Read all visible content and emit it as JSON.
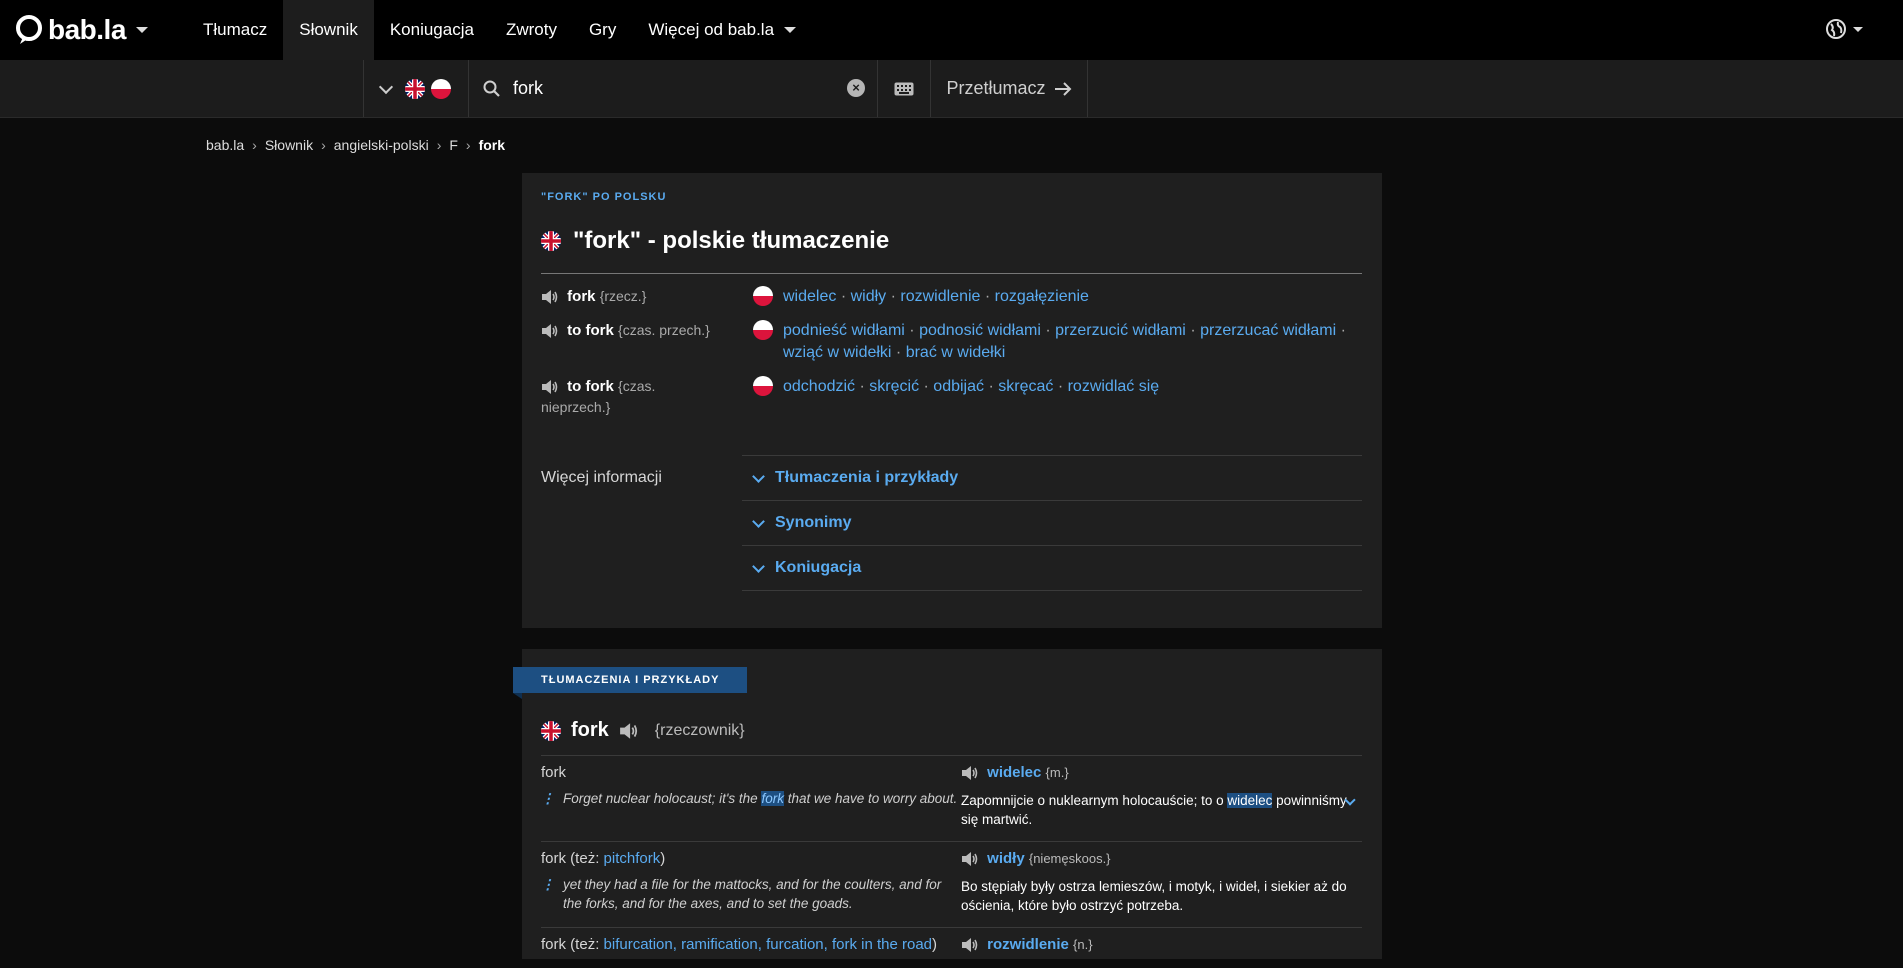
{
  "nav": {
    "logo": "bab.la",
    "items": [
      {
        "label": "Tłumacz",
        "active": false
      },
      {
        "label": "Słownik",
        "active": true
      },
      {
        "label": "Koniugacja",
        "active": false
      },
      {
        "label": "Zwroty",
        "active": false
      },
      {
        "label": "Gry",
        "active": false
      }
    ],
    "more": "Więcej od bab.la"
  },
  "search": {
    "value": "fork",
    "translator": "Przetłumacz"
  },
  "breadcrumb": [
    "bab.la",
    "Słownik",
    "angielski-polski",
    "F",
    "fork"
  ],
  "summary": {
    "eyebrow": "\"FORK\" PO POLSKU",
    "title": "\"fork\" - polskie tłumaczenie",
    "rows": [
      {
        "term": "fork",
        "pos": "{rzecz.}",
        "words": [
          "widelec",
          "widły",
          "rozwidlenie",
          "rozgałęzienie"
        ]
      },
      {
        "term": "to fork",
        "pos": "{czas. przech.}",
        "words": [
          "podnieść widłami",
          "podnosić widłami",
          "przerzucić widłami",
          "przerzucać widłami",
          "wziąć w widełki",
          "brać w widełki"
        ]
      },
      {
        "term": "to fork",
        "pos": "{czas.",
        "pos2": "nieprzech.}",
        "words": [
          "odchodzić",
          "skręcić",
          "odbijać",
          "skręcać",
          "rozwidlać się"
        ]
      }
    ],
    "more_label": "Więcej informacji",
    "accordion": [
      "Tłumaczenia i przykłady",
      "Synonimy",
      "Koniugacja"
    ]
  },
  "examples": {
    "ribbon": "TŁUMACZENIA I PRZYKŁADY",
    "word": "fork",
    "pos": "{rzeczownik}",
    "rows": [
      {
        "src": "fork",
        "src_note_prefix": "",
        "src_note_link": "",
        "src_note_suffix": "",
        "en_pre": "Forget nuclear holocaust; it's the ",
        "en_hl": "fork",
        "en_post": " that we have to worry about.",
        "tgt": "widelec",
        "tgt_gram": "{m.}",
        "pl_pre": "Zapomnijcie o nuklearnym holocauście; to o ",
        "pl_hl": "widelec",
        "pl_post": " powinniśmy się martwić."
      },
      {
        "src": "fork",
        "src_note_prefix": " (też: ",
        "src_note_link": "pitchfork",
        "src_note_suffix": ")",
        "en_pre": "yet they had a file for the mattocks, and for the coulters, and for the forks, and for the axes, and to set the goads.",
        "en_hl": "",
        "en_post": "",
        "tgt": "widły",
        "tgt_gram": "{niemęskoos.}",
        "pl_pre": "Bo stępiały były ostrza lemieszów, i motyk, i wideł, i siekier aż do ościenia, które było ostrzyć potrzeba.",
        "pl_hl": "",
        "pl_post": ""
      },
      {
        "src": "fork",
        "src_note_prefix": " (też: ",
        "src_note_link": "bifurcation, ramification, furcation, fork in the road",
        "src_note_suffix": ")",
        "tgt": "rozwidlenie",
        "tgt_gram": "{n.}"
      }
    ]
  },
  "colors": {
    "accent": "#5aabf0",
    "ribbon": "#1d4f82",
    "card": "#1f1f1f"
  }
}
